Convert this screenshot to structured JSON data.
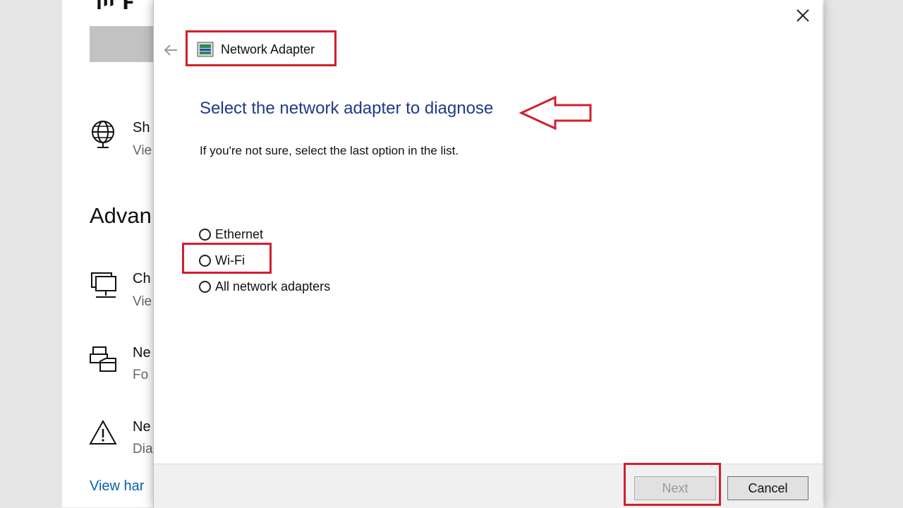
{
  "background_window": {
    "logo_text": "ייו F",
    "rows": [
      {
        "title": "Sh",
        "sub": "Vie",
        "icon": "globe-network-icon"
      },
      {
        "title": "Ch",
        "sub": "Vie",
        "icon": "computer-network-icon"
      },
      {
        "title": "Ne",
        "sub": "Fo",
        "icon": "network-sharing-icon"
      },
      {
        "title": "Ne",
        "sub": "Dia",
        "icon": "warning-icon"
      }
    ],
    "section_heading": "Advan",
    "link": "View har"
  },
  "dialog": {
    "title": "Network Adapter",
    "heading": "Select the network adapter to diagnose",
    "hint": "If you're not sure, select the last option in the list.",
    "options": [
      {
        "label": "Ethernet",
        "selected": false
      },
      {
        "label": "Wi-Fi",
        "selected": false
      },
      {
        "label": "All network adapters",
        "selected": false
      }
    ],
    "buttons": {
      "next": "Next",
      "cancel": "Cancel",
      "next_enabled": false
    }
  },
  "colors": {
    "annotation": "#d11f2f",
    "heading": "#1e3a8a",
    "link": "#0063b1"
  }
}
